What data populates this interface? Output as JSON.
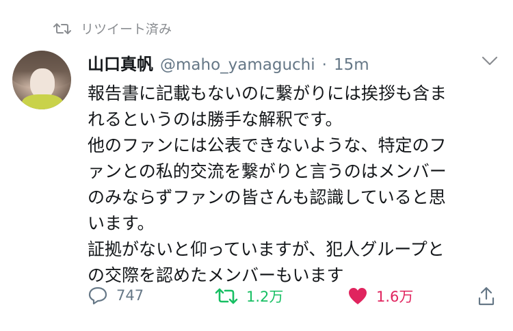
{
  "retweet_label": "リツイート済み",
  "user": {
    "name": "山口真帆",
    "handle": "@maho_yamaguchi",
    "separator": "·",
    "time": "15m"
  },
  "tweet_lines": [
    "報告書に記載もないのに繋がりには挨拶も含ま",
    "れるというのは勝手な解釈です。",
    "他のファンには公表できないような、特定のフ",
    "ァンとの私的交流を繋がりと言うのはメンバー",
    "のみならずファンの皆さんも認識していると思",
    "います。",
    "証拠がないと仰っていますが、犯人グループと",
    "の交際を認めたメンバーもいます"
  ],
  "actions": {
    "reply_count": "747",
    "retweet_count": "1.2万",
    "like_count": "1.6万"
  },
  "colors": {
    "retweeted": "#17bf63",
    "liked": "#e0245e",
    "muted": "#657786"
  },
  "icons": {
    "retweet": "retweet-icon",
    "reply": "reply-icon",
    "like": "heart-icon",
    "share": "share-icon",
    "menu": "chevron-down-icon"
  }
}
